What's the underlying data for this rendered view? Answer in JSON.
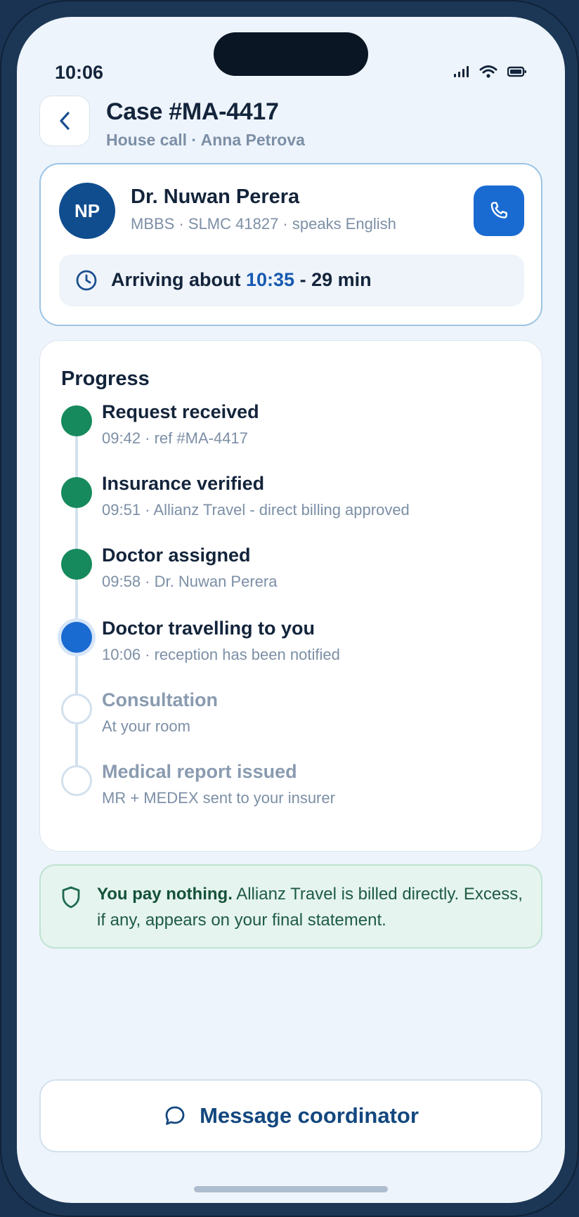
{
  "status_bar": {
    "time": "10:06"
  },
  "header": {
    "title": "Case #MA-4417",
    "subtitle": "House call · Anna Petrova"
  },
  "doctor": {
    "initials": "NP",
    "name": "Dr. Nuwan Perera",
    "meta": "MBBS · SLMC 41827 · speaks English",
    "eta_prefix": "Arriving about ",
    "eta_time": "10:35",
    "eta_suffix": " - 29 min"
  },
  "progress": {
    "title": "Progress",
    "steps": [
      {
        "title": "Request received",
        "sub": "09:42 · ref #MA-4417",
        "state": "done"
      },
      {
        "title": "Insurance verified",
        "sub": "09:51 · Allianz Travel - direct billing approved",
        "state": "done"
      },
      {
        "title": "Doctor assigned",
        "sub": "09:58 · Dr. Nuwan Perera",
        "state": "done"
      },
      {
        "title": "Doctor travelling to you",
        "sub": "10:06 · reception has been notified",
        "state": "active"
      },
      {
        "title": "Consultation",
        "sub": "At your room",
        "state": "pending"
      },
      {
        "title": "Medical report issued",
        "sub": "MR + MEDEX sent to your insurer",
        "state": "pending"
      }
    ]
  },
  "payment_notice": {
    "strong": "You pay nothing.",
    "text": " Allianz Travel is billed directly. Excess, if any, appears on your final statement."
  },
  "actions": {
    "message_label": "Message coordinator"
  },
  "icons": {
    "back": "chevron-left-icon",
    "call": "phone-icon",
    "eta": "clock-icon",
    "payment": "shield-icon",
    "message": "chat-bubble-icon"
  },
  "colors": {
    "accent": "#1a6bd1",
    "done": "#168a5c",
    "pending": "#d3e1ee",
    "pay_bg": "#e5f4ee"
  }
}
